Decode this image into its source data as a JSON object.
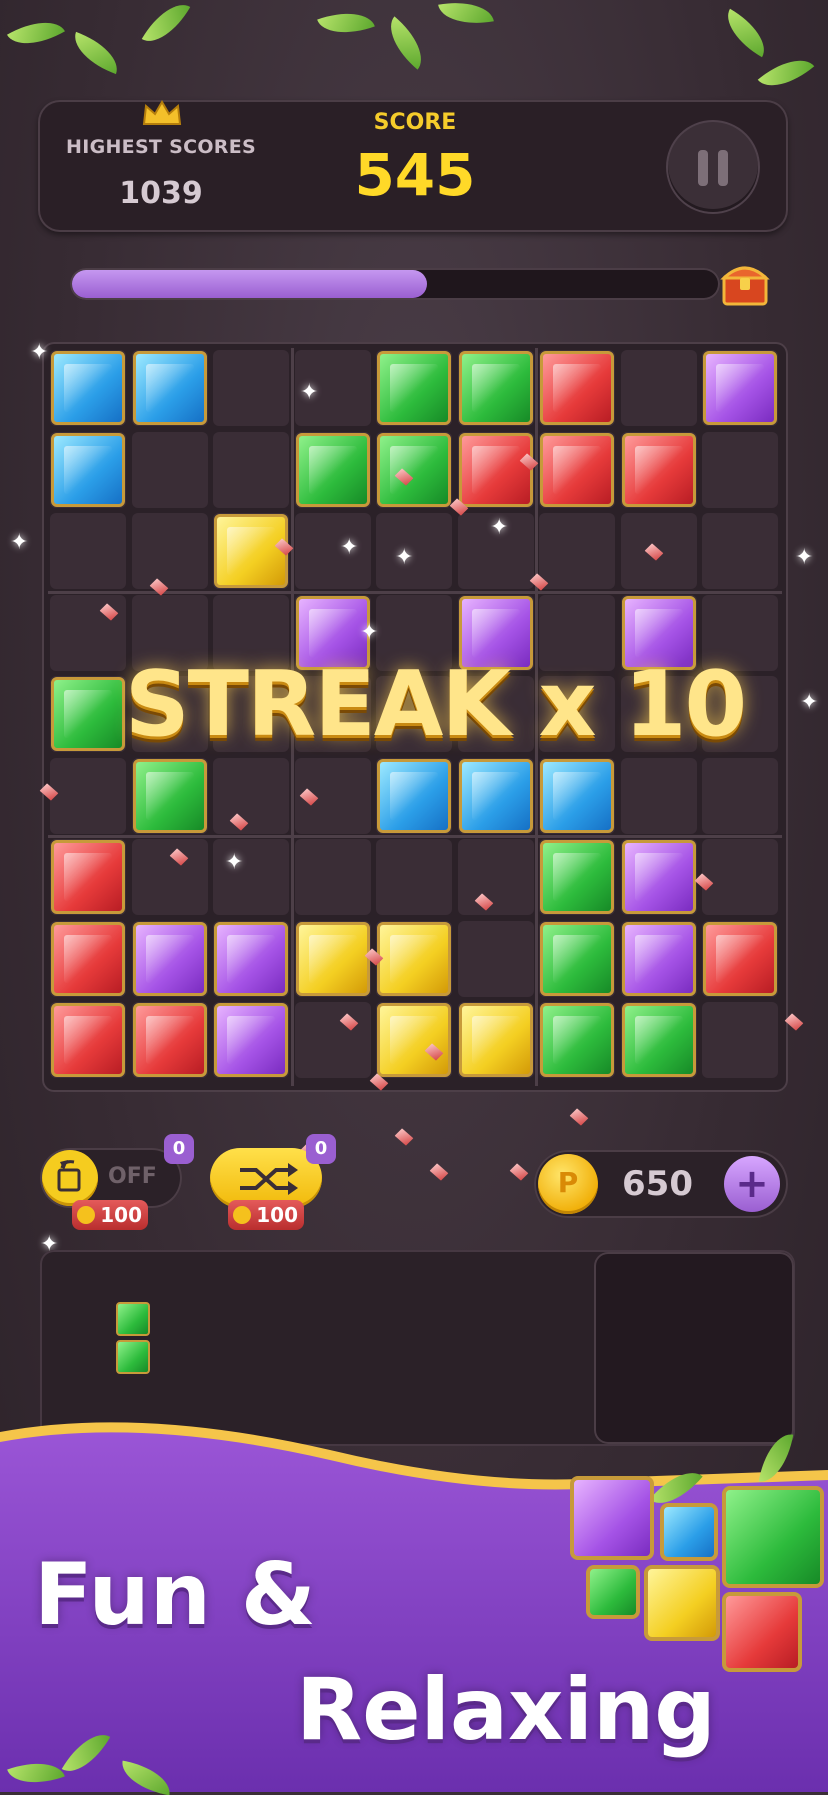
{
  "header": {
    "highest_label": "HIGHEST SCORES",
    "highest_value": "1039",
    "score_label": "SCORE",
    "score_value": "545"
  },
  "progress": {
    "fraction": 0.55
  },
  "board": {
    "rows": [
      [
        "blue",
        "blue",
        "",
        "",
        "green",
        "green",
        "red",
        "",
        "purple"
      ],
      [
        "blue",
        "",
        "",
        "green",
        "green",
        "red",
        "red",
        "red",
        ""
      ],
      [
        "",
        "",
        "yellow",
        "",
        "",
        "",
        "",
        "",
        ""
      ],
      [
        "",
        "",
        "",
        "purple",
        "",
        "purple",
        "",
        "purple",
        ""
      ],
      [
        "green",
        "",
        "",
        "",
        "",
        "",
        "",
        "",
        ""
      ],
      [
        "",
        "green",
        "",
        "",
        "blue",
        "blue",
        "blue",
        "",
        ""
      ],
      [
        "red",
        "",
        "",
        "",
        "",
        "",
        "green",
        "purple",
        ""
      ],
      [
        "red",
        "purple",
        "purple",
        "yellow",
        "yellow",
        "",
        "green",
        "purple",
        "red"
      ],
      [
        "red",
        "red",
        "purple",
        "",
        "yellow",
        "yellow",
        "green",
        "green",
        ""
      ]
    ]
  },
  "streak_text": "STREAK x 10",
  "powerups": {
    "rotate": {
      "state_label": "OFF",
      "count": "0",
      "cost": "100",
      "icon": "rotate-icon"
    },
    "shuffle": {
      "count": "0",
      "cost": "100",
      "icon": "shuffle-icon"
    }
  },
  "coins": {
    "symbol": "P",
    "value": "650",
    "add_label": "+"
  },
  "tray": {
    "pieces": [
      {
        "color": "green",
        "cells": 2
      }
    ]
  },
  "banner": {
    "line1": "Fun &",
    "line2": "Relaxing"
  },
  "colors": {
    "blue": "#2b9ee8",
    "green": "#2dbb3c",
    "red": "#e63a3a",
    "purple": "#a553e6",
    "yellow": "#f4cf22",
    "accent": "#9a5fd1",
    "score": "#ffd928"
  }
}
